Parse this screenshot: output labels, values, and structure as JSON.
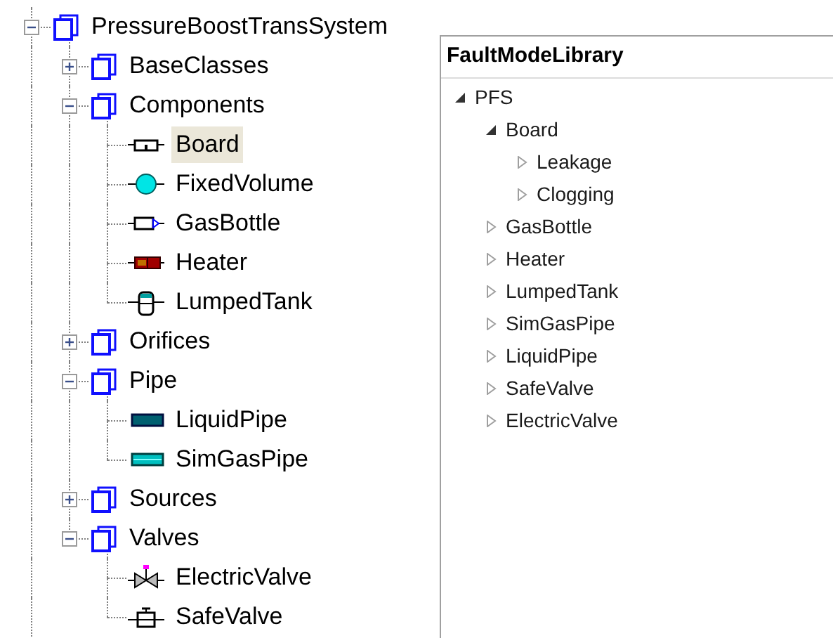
{
  "model_tree": [
    {
      "label": "PressureBoostTransSystem",
      "kind": "package",
      "expanded": true,
      "selected": false,
      "children": [
        {
          "label": "BaseClasses",
          "kind": "package",
          "expanded": false,
          "selected": false
        },
        {
          "label": "Components",
          "kind": "package",
          "expanded": true,
          "selected": false,
          "children": [
            {
              "label": "Board",
              "kind": "board",
              "selected": true
            },
            {
              "label": "FixedVolume",
              "kind": "volume",
              "selected": false
            },
            {
              "label": "GasBottle",
              "kind": "bottle",
              "selected": false
            },
            {
              "label": "Heater",
              "kind": "heater",
              "selected": false
            },
            {
              "label": "LumpedTank",
              "kind": "tank",
              "selected": false
            }
          ]
        },
        {
          "label": "Orifices",
          "kind": "package",
          "expanded": false,
          "selected": false
        },
        {
          "label": "Pipe",
          "kind": "package",
          "expanded": true,
          "selected": false,
          "children": [
            {
              "label": "LiquidPipe",
              "kind": "liquidpipe",
              "selected": false
            },
            {
              "label": "SimGasPipe",
              "kind": "gaspipe",
              "selected": false
            }
          ]
        },
        {
          "label": "Sources",
          "kind": "package",
          "expanded": false,
          "selected": false
        },
        {
          "label": "Valves",
          "kind": "package",
          "expanded": true,
          "selected": false,
          "children": [
            {
              "label": "ElectricValve",
              "kind": "electricvalve",
              "selected": false
            },
            {
              "label": "SafeValve",
              "kind": "safevalve",
              "selected": false
            }
          ]
        }
      ]
    }
  ],
  "library": {
    "title": "FaultModeLibrary",
    "tree": [
      {
        "label": "PFS",
        "expanded": true,
        "children": [
          {
            "label": "Board",
            "expanded": true,
            "children": [
              {
                "label": "Leakage",
                "expanded": false
              },
              {
                "label": "Clogging",
                "expanded": false
              }
            ]
          },
          {
            "label": "GasBottle",
            "expanded": false
          },
          {
            "label": "Heater",
            "expanded": false
          },
          {
            "label": "LumpedTank",
            "expanded": false
          },
          {
            "label": "SimGasPipe",
            "expanded": false
          },
          {
            "label": "LiquidPipe",
            "expanded": false
          },
          {
            "label": "SafeValve",
            "expanded": false
          },
          {
            "label": "ElectricValve",
            "expanded": false
          }
        ]
      }
    ]
  }
}
